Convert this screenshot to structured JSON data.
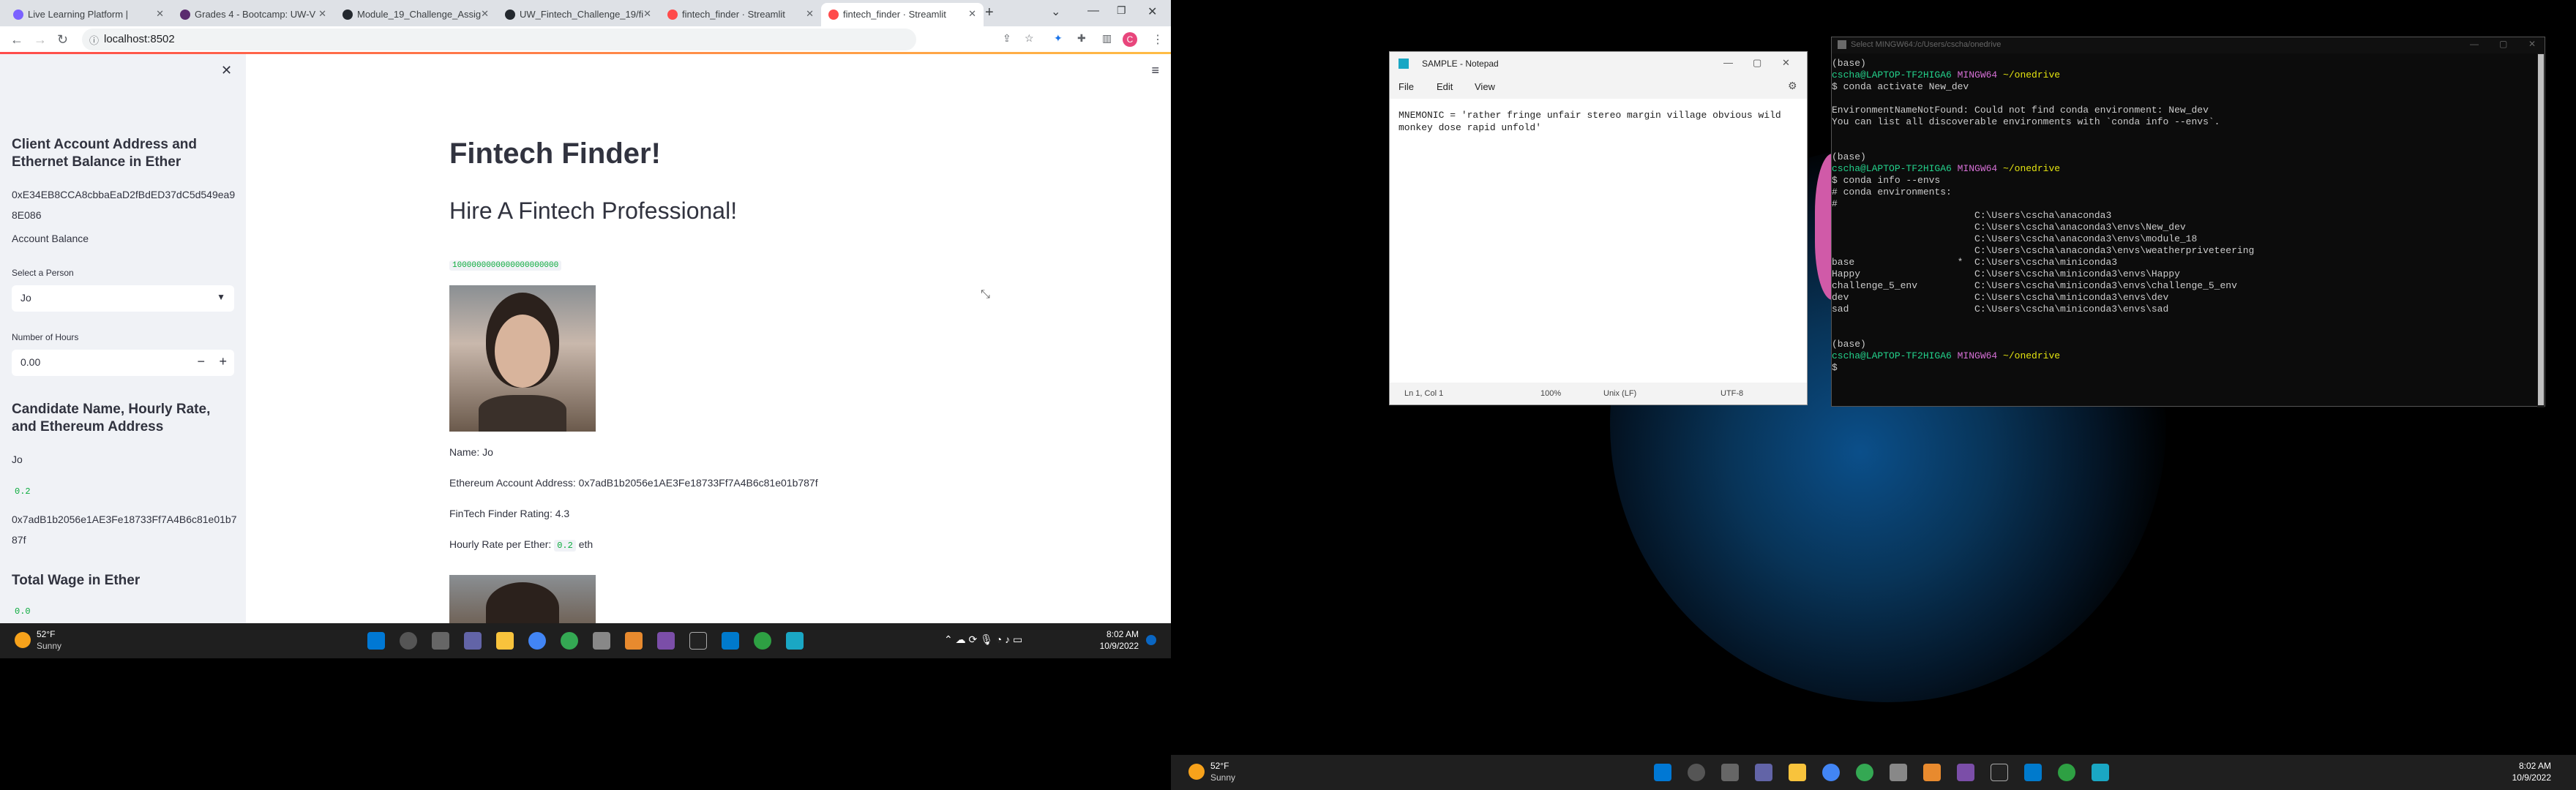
{
  "left_screen": {
    "tabs": [
      {
        "label": "Live Learning Platform |"
      },
      {
        "label": "Grades 4 - Bootcamp: UW-V"
      },
      {
        "label": "Module_19_Challenge_Assig"
      },
      {
        "label": "UW_Fintech_Challenge_19/fi"
      },
      {
        "label": "fintech_finder · Streamlit"
      },
      {
        "label": "fintech_finder · Streamlit"
      }
    ],
    "new_tab": "+",
    "url": "localhost:8502",
    "sidebar": {
      "close": "✕",
      "title1": "Client Account Address and Ethernet Balance in Ether",
      "client_address": "0xE34EB8CCA8cbbaEaD2fBdED37dC5d549ea98E086",
      "balance_label": "Account Balance",
      "select_label": "Select a Person",
      "select_value": "Jo",
      "hours_label": "Number of Hours",
      "hours_value": "0.00",
      "minus": "−",
      "plus": "+",
      "title2": "Candidate Name, Hourly Rate, and Ethereum Address",
      "cand_name": "Jo",
      "cand_rate": "0.2",
      "cand_address": "0x7adB1b2056e1AE3Fe18733Ff7A4B6c81e01b787f",
      "title3": "Total Wage in Ether",
      "total_wage": "0.0"
    },
    "main": {
      "title": "Fintech Finder!",
      "subtitle": "Hire A Fintech Professional!",
      "balance_code": "1000000000000000000000",
      "name_line": "Name: Jo",
      "address_line": "Ethereum Account Address: 0x7adB1b2056e1AE3Fe18733Ff7A4B6c81e01b787f",
      "rating_line": "FinTech Finder Rating: 4.3",
      "rate_prefix": "Hourly Rate per Ether:",
      "rate_code": "0.2",
      "rate_suffix": "eth"
    },
    "taskbar": {
      "weather_temp": "52°F",
      "weather_desc": "Sunny",
      "time": "8:02 AM",
      "date": "10/9/2022"
    }
  },
  "notepad": {
    "title": "SAMPLE - Notepad",
    "menu": [
      "File",
      "Edit",
      "View"
    ],
    "content": "MNEMONIC = 'rather fringe unfair stereo margin village obvious wild monkey dose rapid unfold'",
    "status": [
      "Ln 1, Col 1",
      "100%",
      "Unix (LF)",
      "UTF-8"
    ]
  },
  "terminal": {
    "title": "Select MINGW64:/c/Users/cscha/onedrive",
    "prompt_user": "cscha@LAPTOP-TF2HIGA6",
    "prompt_env": "MINGW64",
    "prompt_dir": "~/onedrive",
    "lines": [
      "(base)",
      "$ conda activate New_dev",
      "",
      "EnvironmentNameNotFound: Could not find conda environment: New_dev",
      "You can list all discoverable environments with `conda info --envs`.",
      "",
      "",
      "(base)",
      "$ conda info --envs",
      "# conda environments:",
      "#",
      "                         C:\\Users\\cscha\\anaconda3",
      "                         C:\\Users\\cscha\\anaconda3\\envs\\New_dev",
      "                         C:\\Users\\cscha\\anaconda3\\envs\\module_18",
      "                         C:\\Users\\cscha\\anaconda3\\envs\\weatherpriveteering",
      "base                  *  C:\\Users\\cscha\\miniconda3",
      "Happy                    C:\\Users\\cscha\\miniconda3\\envs\\Happy",
      "challenge_5_env          C:\\Users\\cscha\\miniconda3\\envs\\challenge_5_env",
      "dev                      C:\\Users\\cscha\\miniconda3\\envs\\dev",
      "sad                      C:\\Users\\cscha\\miniconda3\\envs\\sad",
      "",
      "",
      "(base)",
      "$"
    ]
  },
  "right_taskbar": {
    "weather_temp": "52°F",
    "weather_desc": "Sunny",
    "time": "8:02 AM",
    "date": "10/9/2022"
  },
  "colors": {
    "streamlit_red": "#ff4b4b",
    "code_green": "#09ab3b",
    "term_green": "#23d18b",
    "term_magenta": "#d670d6",
    "term_yellow": "#e5e510"
  }
}
